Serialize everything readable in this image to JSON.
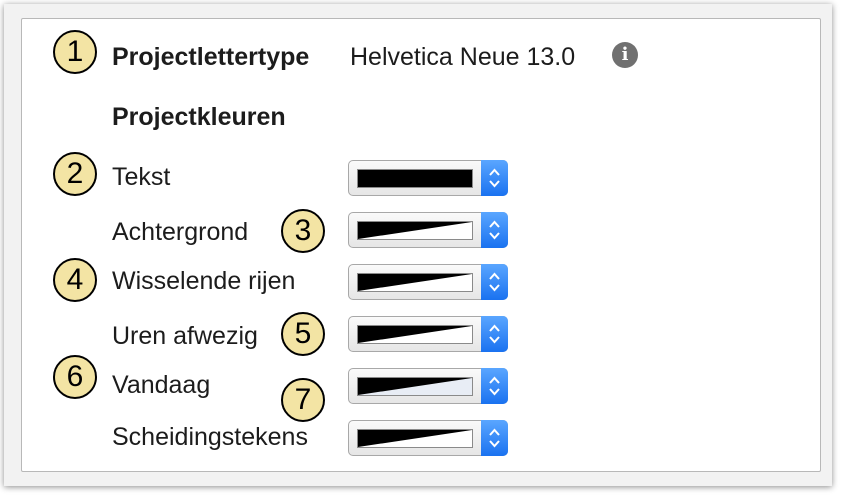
{
  "project_font": {
    "label": "Projectlettertype",
    "value": "Helvetica Neue 13.0",
    "info_icon": "info-icon"
  },
  "project_colors": {
    "heading": "Projectkleuren",
    "rows": [
      {
        "label": "Tekst",
        "swatch": "#000000",
        "swatch_style": "solid"
      },
      {
        "label": "Achtergrond",
        "swatch": "#ffffff",
        "swatch_style": "gradient"
      },
      {
        "label": "Wisselende rijen",
        "swatch": "#ffffff",
        "swatch_style": "gradient"
      },
      {
        "label": "Uren afwezig",
        "swatch": "#ffffff",
        "swatch_style": "gradient"
      },
      {
        "label": "Vandaag",
        "swatch": "#e8edf5",
        "swatch_style": "gradient"
      },
      {
        "label": "Scheidingstekens",
        "swatch": "#ffffff",
        "swatch_style": "gradient"
      }
    ]
  },
  "callouts": [
    "1",
    "2",
    "3",
    "4",
    "5",
    "6",
    "7"
  ],
  "colors": {
    "callout_fill": "#f3e4a4",
    "stepper_blue": "#2b7ff5"
  }
}
